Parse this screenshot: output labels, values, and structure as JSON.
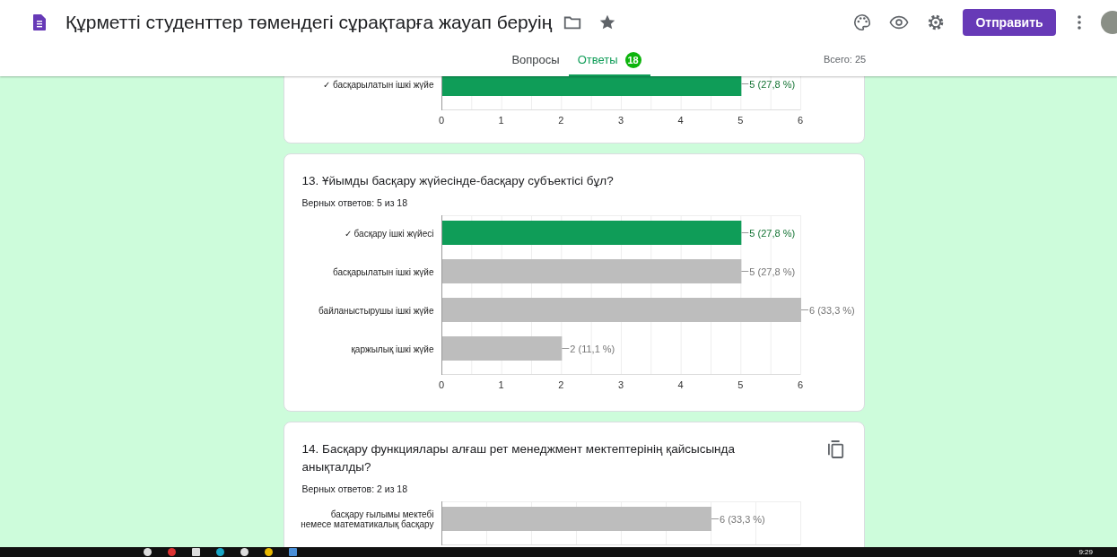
{
  "header": {
    "title": "Құрметті студенттер төмендегі сұрақтарға жауап беруің",
    "send_button": "Отправить"
  },
  "tabs": [
    {
      "label": "Вопросы",
      "selected": false
    },
    {
      "label": "Ответы",
      "selected": true,
      "badge": "18"
    }
  ],
  "total": "Всего: 25",
  "questions": [
    {
      "copy_icon": false,
      "chart_data": {
        "type": "bar",
        "orientation": "horizontal",
        "categories": [
          "✓ басқарылатын ішкі жүйе"
        ],
        "values": [
          5
        ],
        "colors": [
          "#0f9d58"
        ],
        "value_labels": [
          "5 (27,8 %)"
        ],
        "grid": true,
        "xlim": [
          0,
          6
        ],
        "xticks": [
          0,
          1,
          2,
          3,
          4,
          5,
          6
        ]
      }
    },
    {
      "title": "13. Ұйымды басқару жүйесінде-басқару субъектісі бұл?",
      "correct_count": "Верных ответов: 5 из 18",
      "copy_icon": false,
      "chart_data": {
        "type": "bar",
        "orientation": "horizontal",
        "categories": [
          "✓ басқару ішкі жүйесі",
          "басқарылатын ішкі жүйе",
          "байланыстырушы ішкі жүйе",
          "қаржылық ішкі жүйе"
        ],
        "values": [
          5,
          5,
          6,
          2
        ],
        "colors": [
          "#0f9d58",
          "#bdbdbd",
          "#bdbdbd",
          "#bdbdbd"
        ],
        "value_labels": [
          "5 (27,8 %)",
          "5 (27,8 %)",
          "6 (33,3 %)",
          "2 (11,1 %)"
        ],
        "grid": true,
        "xlim": [
          0,
          6
        ],
        "xticks": [
          0,
          1,
          2,
          3,
          4,
          5,
          6
        ]
      }
    },
    {
      "title": "14. Басқару функциялары алғаш рет менеджмент мектептерінің қайсысында анықталды?",
      "correct_count": "Верных ответов: 2 из 18",
      "copy_icon": true,
      "chart_data": {
        "type": "bar",
        "orientation": "horizontal",
        "categories": [
          "басқару ғылымы мектебі немесе математикалық басқару"
        ],
        "values": [
          6
        ],
        "colors": [
          "#bdbdbd"
        ],
        "value_labels": [
          "6 (33,3 %)"
        ],
        "grid": true
      }
    }
  ],
  "taskbar": {
    "time": "9:29"
  }
}
